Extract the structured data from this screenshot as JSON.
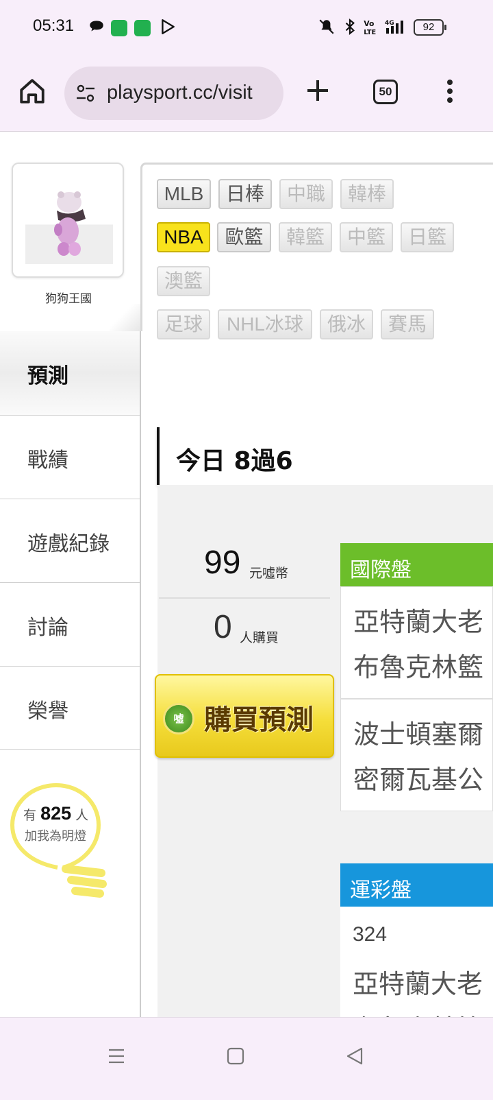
{
  "status_bar": {
    "time": "05:31",
    "battery": "92",
    "icons": [
      "chat-icon",
      "app-icon",
      "app-icon",
      "play-store-icon",
      "mute-icon",
      "bluetooth-icon",
      "volte-icon",
      "signal-4g-icon",
      "battery-icon"
    ]
  },
  "browser": {
    "url": "playsport.cc/visit",
    "tab_count": "50"
  },
  "profile": {
    "username": "狗狗王國"
  },
  "side_nav": {
    "items": [
      "預測",
      "戰績",
      "遊戲紀錄",
      "討論",
      "榮譽"
    ],
    "active": "預測"
  },
  "fans": {
    "prefix": "有",
    "count": "825",
    "suffix": "人",
    "line2": "加我為明燈"
  },
  "sports": {
    "tags": [
      {
        "label": "MLB",
        "state": "enabled"
      },
      {
        "label": "日棒",
        "state": "enabled"
      },
      {
        "label": "中職",
        "state": "disabled"
      },
      {
        "label": "韓棒",
        "state": "disabled"
      },
      {
        "label": "NBA",
        "state": "active"
      },
      {
        "label": "歐籃",
        "state": "enabled"
      },
      {
        "label": "韓籃",
        "state": "disabled"
      },
      {
        "label": "中籃",
        "state": "disabled"
      },
      {
        "label": "日籃",
        "state": "disabled"
      },
      {
        "label": "澳籃",
        "state": "disabled"
      },
      {
        "label": "足球",
        "state": "disabled"
      },
      {
        "label": "NHL冰球",
        "state": "disabled"
      },
      {
        "label": "俄冰",
        "state": "disabled"
      },
      {
        "label": "賽馬",
        "state": "disabled"
      }
    ],
    "active_color": "#f8e21c"
  },
  "today": {
    "label": "今日 8過6"
  },
  "purchase": {
    "price": "99",
    "price_unit": "元噓幣",
    "buyers": "0",
    "buyers_unit": "人購買",
    "buy_button": "購買預測",
    "coin_label": "噓"
  },
  "international": {
    "header": "國際盤",
    "color": "#6cbe2a",
    "matches": [
      {
        "team1": "亞特蘭大老",
        "team2": "布魯克林籃"
      },
      {
        "team1": "波士頓塞爾",
        "team2": "密爾瓦基公"
      }
    ]
  },
  "lottery": {
    "header": "運彩盤",
    "color": "#1796dc",
    "number": "324",
    "team1": "亞特蘭大老",
    "team2": "布魯克林籃"
  }
}
